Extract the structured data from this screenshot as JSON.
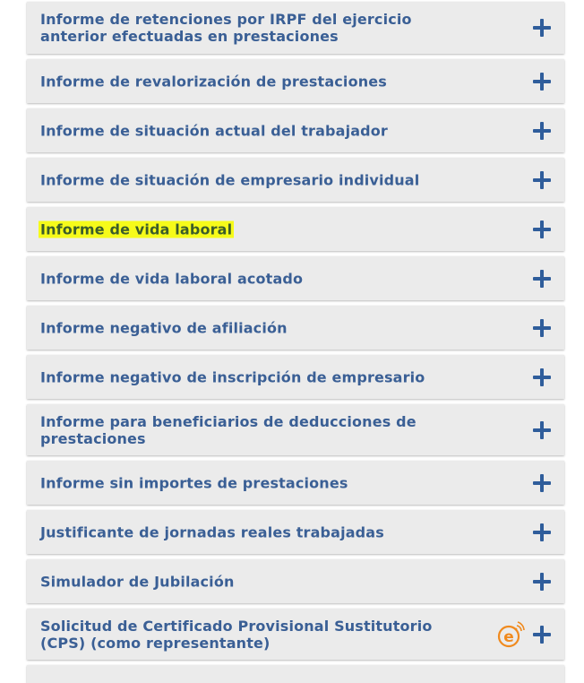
{
  "items": [
    {
      "label": "Informe de retenciones por IRPF del ejercicio anterior efectuadas en prestaciones"
    },
    {
      "label": "Informe de revalorización de prestaciones"
    },
    {
      "label": "Informe de situación actual del trabajador"
    },
    {
      "label": "Informe de situación de empresario individual"
    },
    {
      "label": "Informe de vida laboral"
    },
    {
      "label": "Informe de vida laboral acotado"
    },
    {
      "label": "Informe negativo de afiliación"
    },
    {
      "label": "Informe negativo de inscripción de empresario"
    },
    {
      "label": "Informe para beneficiarios de deducciones de prestaciones"
    },
    {
      "label": "Informe sin importes de prestaciones"
    },
    {
      "label": "Justificante de jornadas reales trabajadas"
    },
    {
      "label": "Simulador de Jubilación"
    },
    {
      "label": "Solicitud de Certificado Provisional Sustitutorio (CPS) (como representante)"
    }
  ],
  "colors": {
    "label": "#3a5f95",
    "highlight": "#f6fb1a",
    "plus": "#2f5d9b",
    "badge": "#f08a1e"
  },
  "icons": {
    "expand": "plus-icon",
    "badge": "electronic-badge-icon"
  }
}
